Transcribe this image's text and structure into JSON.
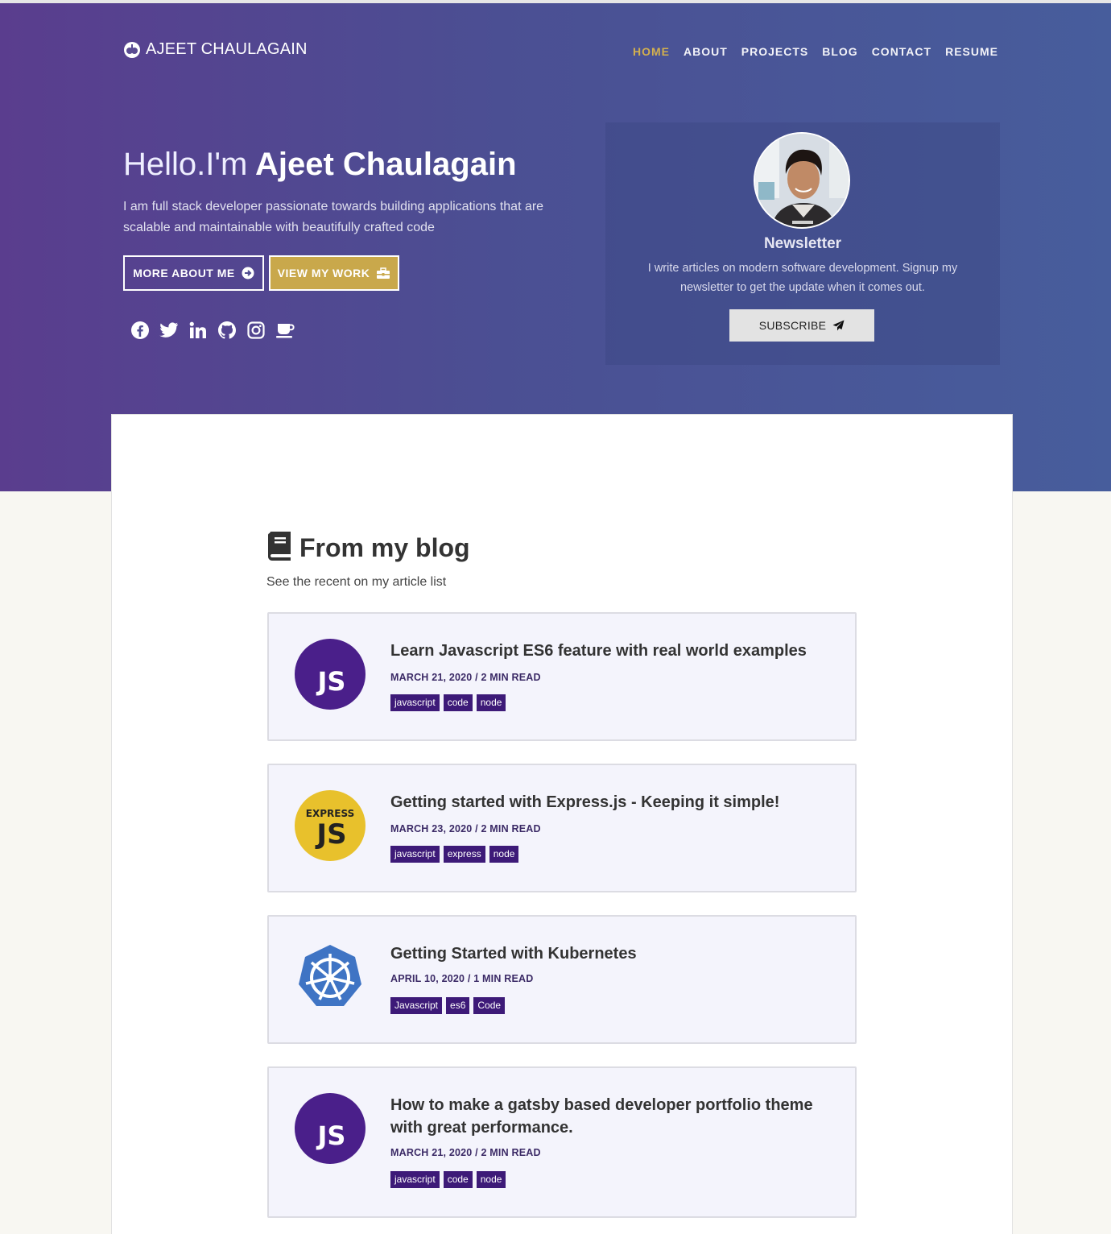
{
  "header": {
    "brand": "AJEET CHAULAGAIN",
    "nav": [
      {
        "label": "HOME",
        "active": true
      },
      {
        "label": "ABOUT",
        "active": false
      },
      {
        "label": "PROJECTS",
        "active": false
      },
      {
        "label": "BLOG",
        "active": false
      },
      {
        "label": "CONTACT",
        "active": false
      },
      {
        "label": "RESUME",
        "active": false
      }
    ]
  },
  "hero": {
    "greeting": "Hello.I'm",
    "name": "Ajeet Chaulagain",
    "intro": "I am full stack developer passionate towards building applications that are scalable and maintainable with beautifully crafted code",
    "more_label": "MORE ABOUT ME",
    "work_label": "VIEW MY WORK",
    "social_icons": [
      "facebook-icon",
      "twitter-icon",
      "linkedin-icon",
      "github-icon",
      "instagram-icon",
      "coffee-icon"
    ]
  },
  "newsletter": {
    "title": "Newsletter",
    "text": "I write articles on modern software development. Signup my newsletter to get the update when it comes out.",
    "button": "SUBSCRIBE"
  },
  "blog": {
    "title": "From my blog",
    "subtitle": "See the recent on my article list",
    "posts": [
      {
        "thumb": "js-logo-icon",
        "title": "Learn Javascript ES6 feature with real world examples",
        "meta": "MARCH 21, 2020 / 2 MIN READ",
        "tags": [
          "javascript",
          "code",
          "node"
        ]
      },
      {
        "thumb": "express-js-logo-icon",
        "title": "Getting started with Express.js - Keeping it simple!",
        "meta": "MARCH 23, 2020 / 2 MIN READ",
        "tags": [
          "javascript",
          "express",
          "node"
        ]
      },
      {
        "thumb": "kubernetes-logo-icon",
        "title": "Getting Started with Kubernetes",
        "meta": "APRIL 10, 2020 / 1 MIN READ",
        "tags": [
          "Javascript",
          "es6",
          "Code"
        ]
      },
      {
        "thumb": "js-logo-icon",
        "title": "How to make a gatsby based developer portfolio theme with great performance.",
        "meta": "MARCH 21, 2020 / 2 MIN READ",
        "tags": [
          "javascript",
          "code",
          "node"
        ]
      }
    ]
  },
  "colors": {
    "accent": "#c9a84b",
    "tag": "#3d1a78",
    "hero_start": "#5a3d8e",
    "hero_end": "#475d9c"
  }
}
